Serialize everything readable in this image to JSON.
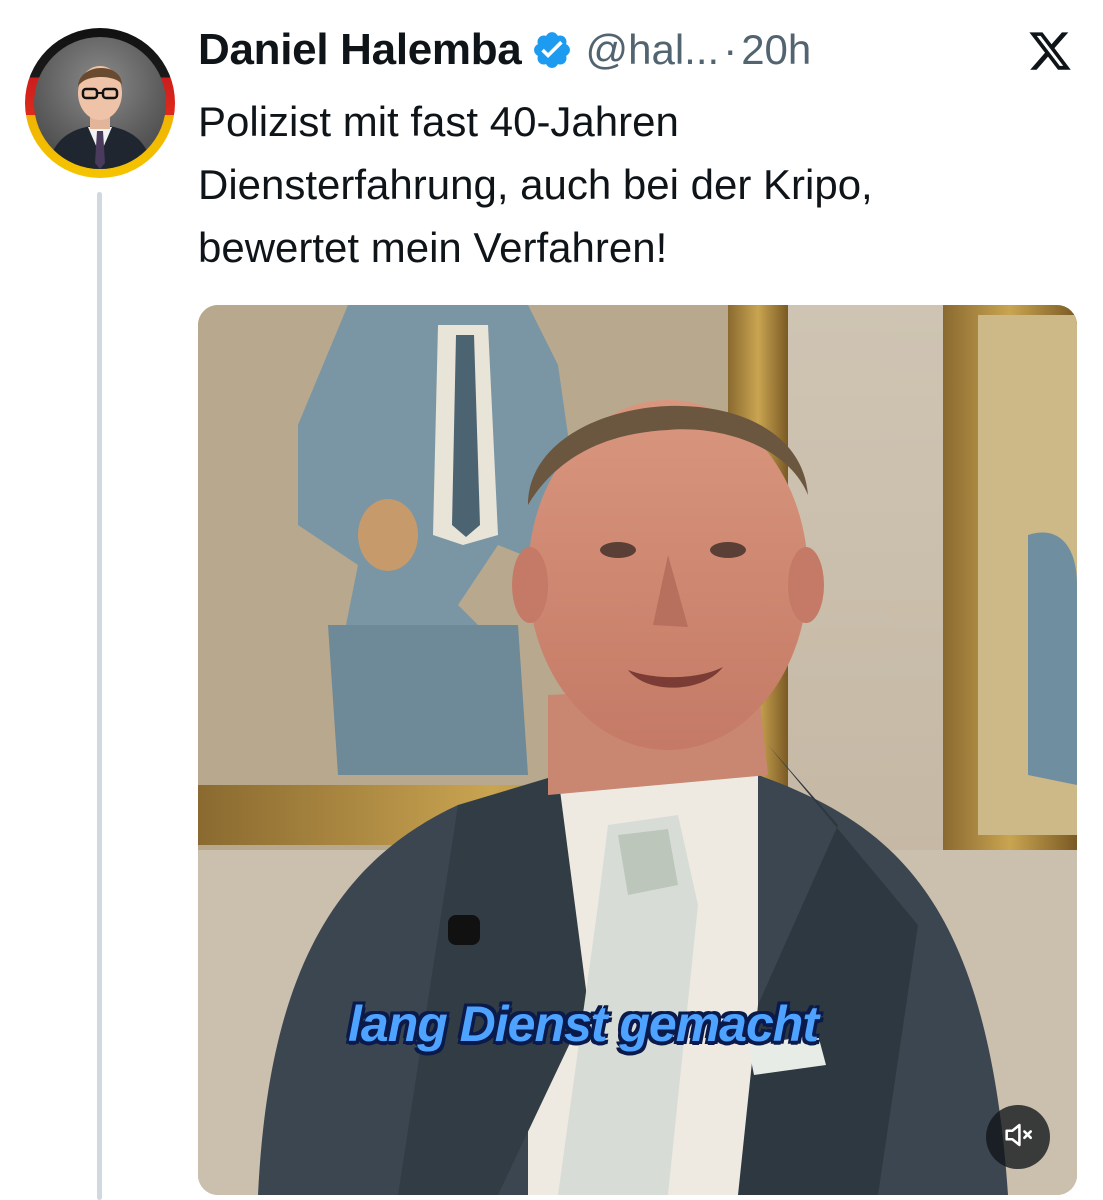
{
  "tweet": {
    "display_name": "Daniel Halemba",
    "handle": "@hal...",
    "separator": "·",
    "time": "20h",
    "text_lines": [
      "Polizist mit fast 40-Jahren",
      "Diensterfahrung, auch bei der Kripo,",
      "bewertet mein Verfahren!"
    ]
  },
  "media": {
    "subtitle": "lang Dienst gemacht"
  },
  "icons": {
    "verified": "verified-badge-icon",
    "platform_logo": "x-logo-icon",
    "mute": "speaker-muted-icon"
  },
  "colors": {
    "verified_blue": "#1d9bf0",
    "subtitle_blue": "#4da3ff",
    "secondary_text": "#536471",
    "thread_line": "#cfd9de"
  }
}
